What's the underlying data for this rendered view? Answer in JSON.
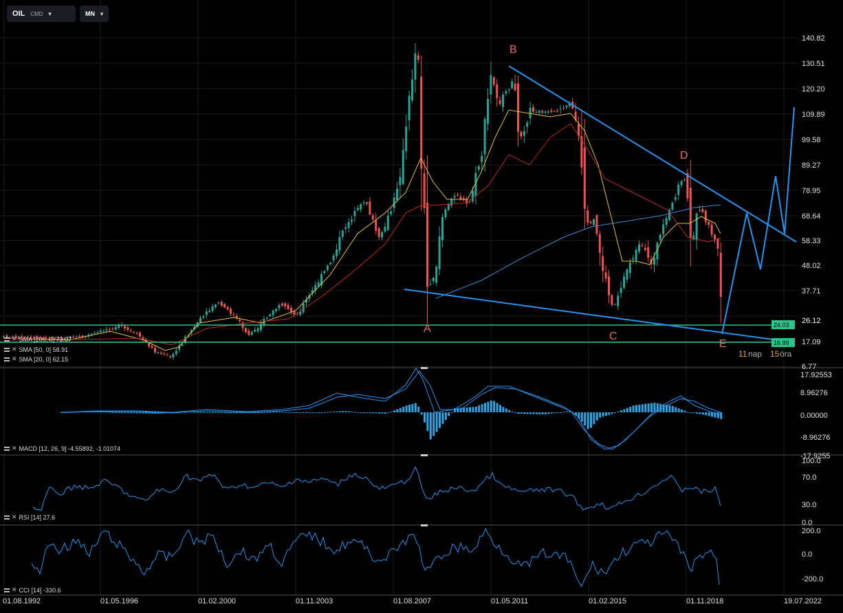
{
  "toolbar": {
    "symbol": "OIL",
    "type": "CMD",
    "period": "MN"
  },
  "colors": {
    "bg": "#000000",
    "up": "#26a69a",
    "down": "#ef5350",
    "blue": "#1e88e5",
    "green": "#2bc48a",
    "sma200": "#2f8fd8",
    "sma50": "#c0281e",
    "sma20": "#e8c237"
  },
  "price_axis": [
    "140.82",
    "130.51",
    "120.20",
    "109.89",
    "99.58",
    "89.27",
    "78.95",
    "68.64",
    "58.33",
    "48.02",
    "37.71",
    "17.09",
    "6.77"
  ],
  "price_badges": {
    "current": "26.12",
    "green1": "24.03",
    "green2": "16.99"
  },
  "countdown": {
    "days": "11",
    "days_unit": "nap",
    "hours": "15",
    "hours_unit": "óra"
  },
  "wave_labels": {
    "a": "A",
    "b": "B",
    "c": "C",
    "d": "D",
    "e": "E"
  },
  "date_axis": [
    "01.08.1992",
    "01.05.1996",
    "01.02.2000",
    "01.11.2003",
    "01.08.2007",
    "01.05.2011",
    "01.02.2015",
    "01.11.2018",
    "19.07.2022"
  ],
  "legends": {
    "sma200": "SMA [200, 0] 73.07",
    "sma50": "SMA [50, 0] 58.91",
    "sma20": "SMA [20, 0] 62.15",
    "macd": "MACD [12, 26, 9] -4.55892, -1.01074",
    "rsi": "RSI [14] 27.6",
    "cci": "CCI [14] -330.6"
  },
  "macd_axis": [
    "17.92553",
    "8.96276",
    "0.00000",
    "-8.96276",
    "-17.9255"
  ],
  "rsi_axis": [
    "100.0",
    "70.0",
    "30.0",
    "0.0"
  ],
  "cci_axis": [
    "200.0",
    "0.0",
    "-200.0"
  ]
}
